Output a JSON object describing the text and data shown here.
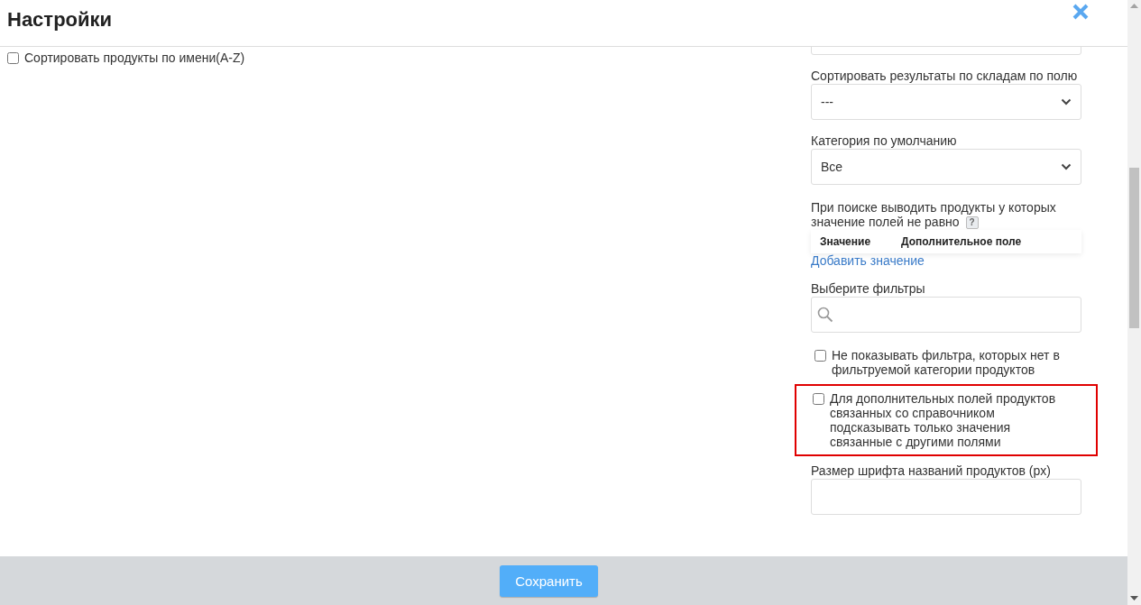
{
  "window": {
    "title": "Настройки"
  },
  "left_options": [
    {
      "label": "Сортировать продукты по имени(А-Z)",
      "checked": false
    }
  ],
  "fields": [
    {
      "kind": "input"
    },
    {
      "kind": "select",
      "label": "Сортировать результаты по складам по полю",
      "value": "---"
    },
    {
      "kind": "select",
      "label": "Категория по умолчанию",
      "value": "Все"
    },
    {
      "kind": "table",
      "label": "При поиске выводить продукты у которых значение полей не равно",
      "help": "?",
      "columns": [
        "Значение",
        "Дополнительное поле"
      ],
      "link": "Добавить значение"
    },
    {
      "kind": "search",
      "label": "Выберите фильтры"
    },
    {
      "kind": "checkbox",
      "label": "Не показывать фильтра, которых нет в фильтруемой категории продуктов",
      "checked": false,
      "highlighted": false
    },
    {
      "kind": "checkbox",
      "label": "Для дополнительных полей продуктов связанных со справочником подсказывать только значения связанные с другими полями",
      "checked": false,
      "highlighted": true
    },
    {
      "kind": "input",
      "label": "Размер шрифта названий продуктов (px)"
    }
  ],
  "footer": {
    "save_button": "Сохранить"
  }
}
